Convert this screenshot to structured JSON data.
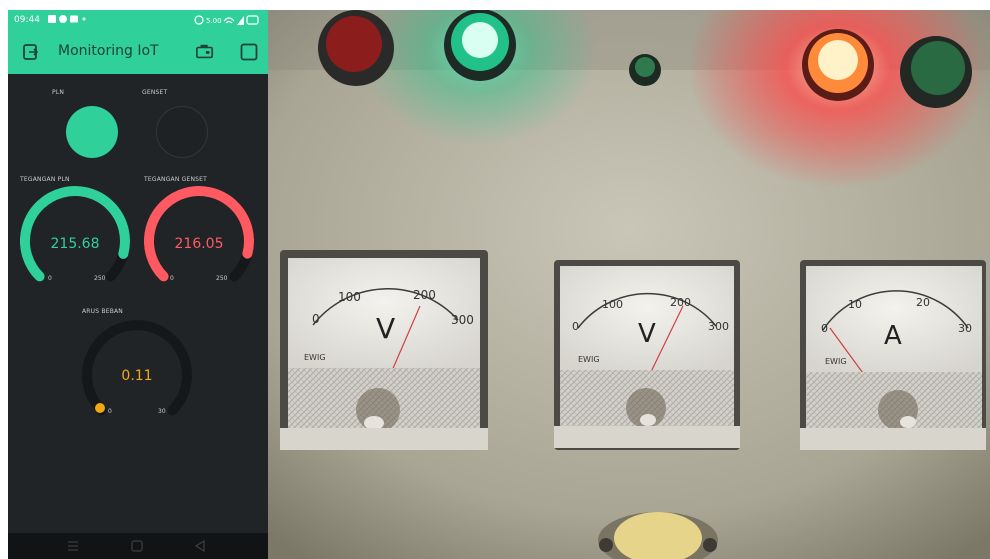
{
  "status_bar": {
    "time": "09:44",
    "left_icons": [
      "notification-square-icon",
      "app-icon",
      "image-icon",
      "dot-icon"
    ],
    "right_icons": [
      "alarm-icon",
      "data-speed-icon",
      "wifi-icon",
      "signal-icon",
      "battery-icon"
    ],
    "data_speed": "5.00"
  },
  "app_bar": {
    "title": "Monitoring IoT",
    "accent": "#2fd09a"
  },
  "leds": [
    {
      "label": "PLN",
      "state": "on",
      "color": "#2fd09a"
    },
    {
      "label": "GENSET",
      "state": "off",
      "color": "#ff5a62"
    }
  ],
  "gauges": [
    {
      "label": "TEGANGAN PLN",
      "value": "215.68",
      "min": "0",
      "max": "250",
      "fraction": 0.863,
      "color": "#2fd09a"
    },
    {
      "label": "TEGANGAN GENSET",
      "value": "216.05",
      "min": "0",
      "max": "250",
      "fraction": 0.864,
      "color": "#ff5a62"
    },
    {
      "label": "ARUS BEBAN",
      "value": "0.11",
      "min": "0",
      "max": "30",
      "fraction": 0.004,
      "color": "#f3a713"
    }
  ],
  "nav_icons": [
    "menu-icon",
    "home-icon",
    "back-icon"
  ],
  "photo": {
    "meters": [
      {
        "unit": "V",
        "brand": "EWIG",
        "scale": [
          "0",
          "100",
          "200",
          "300"
        ]
      },
      {
        "unit": "V",
        "brand": "EWIG",
        "scale": [
          "0",
          "100",
          "200",
          "300"
        ]
      },
      {
        "unit": "A",
        "brand": "EWIG",
        "scale": [
          "0",
          "10",
          "20",
          "30"
        ]
      }
    ]
  }
}
